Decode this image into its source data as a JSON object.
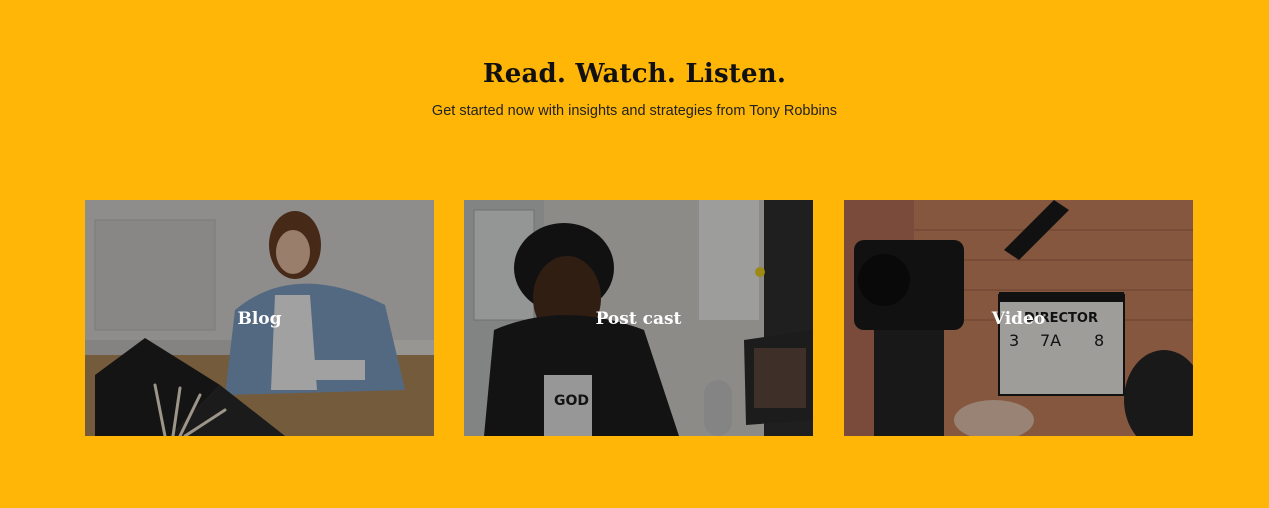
{
  "section": {
    "title": "Read. Watch. Listen.",
    "subtitle": "Get started now with insights and strategies from Tony Robbins"
  },
  "cards": [
    {
      "label": "Blog",
      "image": "woman-at-laptop-photo"
    },
    {
      "label": "Post cast",
      "image": "man-podcasting-photo"
    },
    {
      "label": "Video",
      "image": "film-clapperboard-photo"
    }
  ],
  "colors": {
    "background": "#FFB606",
    "heading": "#111111",
    "card_label": "#FFFFFF"
  }
}
